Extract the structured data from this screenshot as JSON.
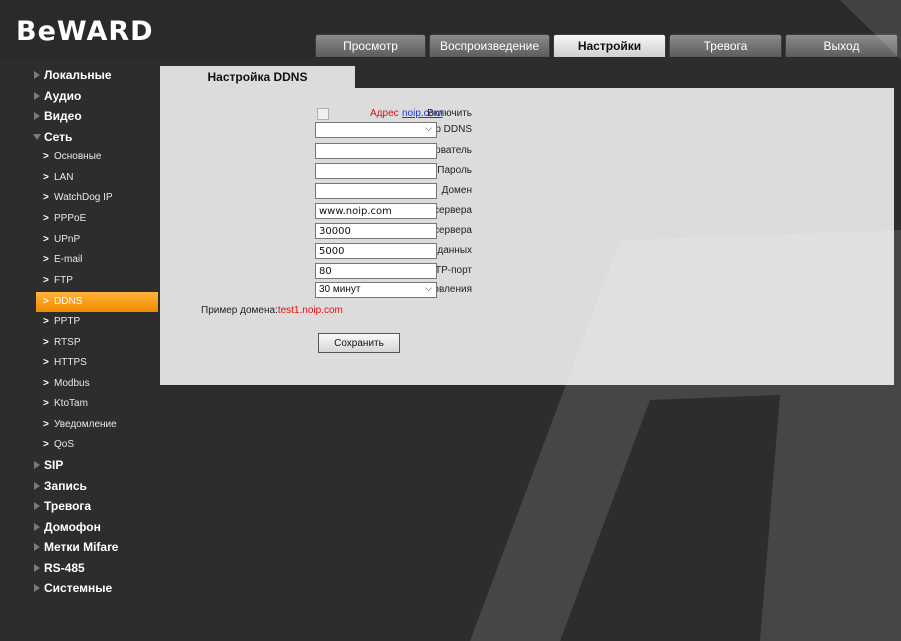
{
  "logo": "BeWARD",
  "tabs": [
    {
      "label": "Просмотр",
      "active": false
    },
    {
      "label": "Воспроизведение",
      "active": false
    },
    {
      "label": "Настройки",
      "active": true
    },
    {
      "label": "Тревога",
      "active": false
    },
    {
      "label": "Выход",
      "active": false
    }
  ],
  "sidebar": {
    "items": [
      {
        "label": "Локальные",
        "level": 1
      },
      {
        "label": "Аудио",
        "level": 1
      },
      {
        "label": "Видео",
        "level": 1
      },
      {
        "label": "Сеть",
        "level": 1,
        "expanded": true
      },
      {
        "label": "Основные",
        "level": 2
      },
      {
        "label": "LAN",
        "level": 2
      },
      {
        "label": "WatchDog IP",
        "level": 2
      },
      {
        "label": "PPPoE",
        "level": 2
      },
      {
        "label": "UPnP",
        "level": 2
      },
      {
        "label": "E-mail",
        "level": 2
      },
      {
        "label": "FTP",
        "level": 2
      },
      {
        "label": "DDNS",
        "level": 2,
        "active": true
      },
      {
        "label": "PPTP",
        "level": 2
      },
      {
        "label": "RTSP",
        "level": 2
      },
      {
        "label": "HTTPS",
        "level": 2
      },
      {
        "label": "Modbus",
        "level": 2
      },
      {
        "label": "KtoTam",
        "level": 2
      },
      {
        "label": "Уведомление",
        "level": 2
      },
      {
        "label": "QoS",
        "level": 2
      },
      {
        "label": "SIP",
        "level": 1
      },
      {
        "label": "Запись",
        "level": 1
      },
      {
        "label": "Тревога",
        "level": 1
      },
      {
        "label": "Домофон",
        "level": 1
      },
      {
        "label": "Метки Mifare",
        "level": 1
      },
      {
        "label": "RS-485",
        "level": 1
      },
      {
        "label": "Системные",
        "level": 1
      }
    ]
  },
  "content": {
    "tab_title": "Настройка DDNS",
    "enable_label": "Включить",
    "enable_checked": false,
    "address_label": "Адрес",
    "address_link": "noip.com",
    "server_label": "Сервер DDNS",
    "server_value": "",
    "user_label": "Пользователь",
    "user_value": "",
    "password_label": "Пароль",
    "password_value": "",
    "domain_label": "Домен",
    "domain_value": "",
    "server_addr_label": "Адрес сервера",
    "server_addr_value": "www.noip.com",
    "server_port_label": "Порт сервера",
    "server_port_value": "30000",
    "data_port_label": "Порт данных",
    "data_port_value": "5000",
    "http_port_label": "HTTP-порт",
    "http_port_value": "80",
    "interval_label": "Интервал обновления",
    "interval_value": "30 минут",
    "example_label": "Пример домена:",
    "example_value": "test1.noip.com",
    "save_label": "Сохранить"
  },
  "colors": {
    "background": "#2d2d2d",
    "panel": "#dcdcdc",
    "accent": "#f59a10",
    "warning_text": "#e01010",
    "link": "#1a3bd8"
  }
}
